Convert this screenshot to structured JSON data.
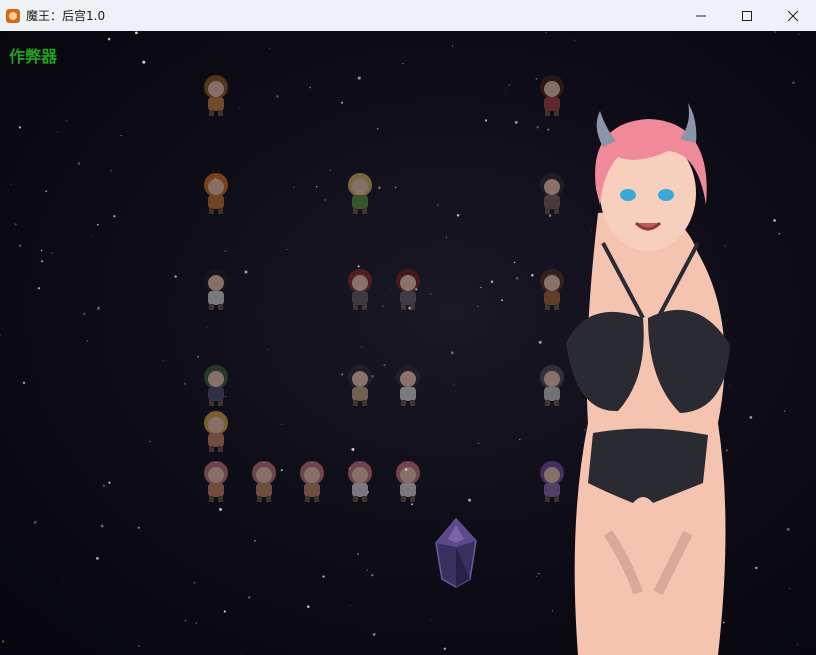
{
  "window": {
    "title": "魔王：后宫1.0",
    "icon": "app-icon",
    "controls": [
      "minimize-icon",
      "maximize-icon",
      "close-icon"
    ]
  },
  "game": {
    "cheat_label": "作弊器",
    "colors": {
      "cheat_label": "#1fa31f",
      "background": "#0f0d18",
      "heroine_hair": "#f08a9a",
      "heroine_bikini": "#2a2a33",
      "crystal": "#5a4a8a"
    },
    "sprites": [
      {
        "id": "s1",
        "hair": "#8a5a2a",
        "outfit": "#c08040"
      },
      {
        "id": "s2",
        "hair": "#3a2418",
        "outfit": "#a04040"
      },
      {
        "id": "s3",
        "hair": "#d2691e",
        "outfit": "#c07030"
      },
      {
        "id": "s4",
        "hair": "#c8b060",
        "outfit": "#5a8a3a"
      },
      {
        "id": "s5",
        "hair": "#2a2a2a",
        "outfit": "#7a5a5a"
      },
      {
        "id": "s6",
        "hair": "#1a1a1a",
        "outfit": "#d0d0d0"
      },
      {
        "id": "s7",
        "hair": "#7a2a1a",
        "outfit": "#5a5a5a"
      },
      {
        "id": "s8",
        "hair": "#6a1a1a",
        "outfit": "#5a5a5a"
      },
      {
        "id": "s9",
        "hair": "#4a3020",
        "outfit": "#a06030"
      },
      {
        "id": "s10",
        "hair": "#3a5a3a",
        "outfit": "#4a4a6a"
      },
      {
        "id": "s11",
        "hair": "#2a2a2a",
        "outfit": "#c0a080"
      },
      {
        "id": "s12",
        "hair": "#2a2a2a",
        "outfit": "#d0d0d0"
      },
      {
        "id": "s13",
        "hair": "#4a4a4a",
        "outfit": "#c0c0c0"
      },
      {
        "id": "s14",
        "hair": "#d0a040",
        "outfit": "#c08060"
      },
      {
        "id": "s15",
        "hair": "#c07080",
        "outfit": "#c08060"
      },
      {
        "id": "s16",
        "hair": "#c07080",
        "outfit": "#c08060"
      },
      {
        "id": "s17",
        "hair": "#c07080",
        "outfit": "#c08060"
      },
      {
        "id": "s18",
        "hair": "#c07080",
        "outfit": "#d0d0d0"
      },
      {
        "id": "s19",
        "hair": "#c07080",
        "outfit": "#d0d0d0"
      },
      {
        "id": "s20",
        "hair": "#6a4a9a",
        "outfit": "#8a6aaa"
      }
    ]
  }
}
